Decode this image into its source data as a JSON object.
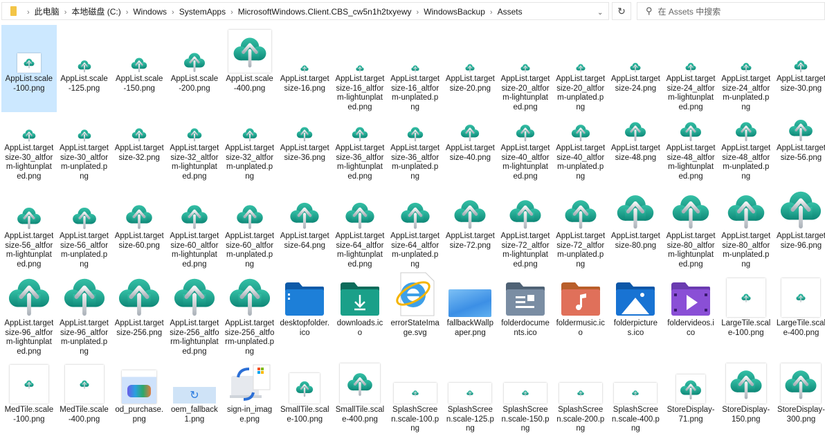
{
  "address_bar": {
    "breadcrumb": [
      "此电脑",
      "本地磁盘 (C:)",
      "Windows",
      "SystemApps",
      "MicrosoftWindows.Client.CBS_cw5n1h2txyewy",
      "WindowsBackup",
      "Assets"
    ]
  },
  "search": {
    "placeholder": "在 Assets 中搜索"
  },
  "icons": {
    "refresh": "refresh-icon",
    "dropdown": "chevron-down-icon",
    "search": "search-icon"
  },
  "colors": {
    "selection": "#cce8ff",
    "cloud": "#1fa38f"
  },
  "files": [
    {
      "name": "AppList.scale-100.png",
      "icon": "cloud-thumb"
    },
    {
      "name": "AppList.scale-125.png",
      "icon": "cloud"
    },
    {
      "name": "AppList.scale-150.png",
      "icon": "cloud"
    },
    {
      "name": "AppList.scale-200.png",
      "icon": "cloud"
    },
    {
      "name": "AppList.scale-400.png",
      "icon": "cloud-thumb"
    },
    {
      "name": "AppList.targetsize-16.png",
      "icon": "cloud"
    },
    {
      "name": "AppList.targetsize-16_altform-lightunplated.png",
      "icon": "cloud"
    },
    {
      "name": "AppList.targetsize-16_altform-unplated.png",
      "icon": "cloud"
    },
    {
      "name": "AppList.targetsize-20.png",
      "icon": "cloud"
    },
    {
      "name": "AppList.targetsize-20_altform-lightunplated.png",
      "icon": "cloud"
    },
    {
      "name": "AppList.targetsize-20_altform-unplated.png",
      "icon": "cloud"
    },
    {
      "name": "AppList.targetsize-24.png",
      "icon": "cloud"
    },
    {
      "name": "AppList.targetsize-24_altform-lightunplated.png",
      "icon": "cloud"
    },
    {
      "name": "AppList.targetsize-24_altform-unplated.png",
      "icon": "cloud"
    },
    {
      "name": "AppList.targetsize-30.png",
      "icon": "cloud"
    },
    {
      "name": "AppList.targetsize-30_altform-lightunplated.png",
      "icon": "cloud"
    },
    {
      "name": "AppList.targetsize-30_altform-unplated.png",
      "icon": "cloud"
    },
    {
      "name": "AppList.targetsize-32.png",
      "icon": "cloud"
    },
    {
      "name": "AppList.targetsize-32_altform-lightunplated.png",
      "icon": "cloud"
    },
    {
      "name": "AppList.targetsize-32_altform-unplated.png",
      "icon": "cloud"
    },
    {
      "name": "AppList.targetsize-36.png",
      "icon": "cloud"
    },
    {
      "name": "AppList.targetsize-36_altform-lightunplated.png",
      "icon": "cloud"
    },
    {
      "name": "AppList.targetsize-36_altform-unplated.png",
      "icon": "cloud"
    },
    {
      "name": "AppList.targetsize-40.png",
      "icon": "cloud"
    },
    {
      "name": "AppList.targetsize-40_altform-lightunplated.png",
      "icon": "cloud"
    },
    {
      "name": "AppList.targetsize-40_altform-unplated.png",
      "icon": "cloud"
    },
    {
      "name": "AppList.targetsize-48.png",
      "icon": "cloud"
    },
    {
      "name": "AppList.targetsize-48_altform-lightunplated.png",
      "icon": "cloud"
    },
    {
      "name": "AppList.targetsize-48_altform-unplated.png",
      "icon": "cloud"
    },
    {
      "name": "AppList.targetsize-56.png",
      "icon": "cloud"
    },
    {
      "name": "AppList.targetsize-56_altform-lightunplated.png",
      "icon": "cloud"
    },
    {
      "name": "AppList.targetsize-56_altform-unplated.png",
      "icon": "cloud"
    },
    {
      "name": "AppList.targetsize-60.png",
      "icon": "cloud"
    },
    {
      "name": "AppList.targetsize-60_altform-lightunplated.png",
      "icon": "cloud"
    },
    {
      "name": "AppList.targetsize-60_altform-unplated.png",
      "icon": "cloud"
    },
    {
      "name": "AppList.targetsize-64.png",
      "icon": "cloud"
    },
    {
      "name": "AppList.targetsize-64_altform-lightunplated.png",
      "icon": "cloud"
    },
    {
      "name": "AppList.targetsize-64_altform-unplated.png",
      "icon": "cloud"
    },
    {
      "name": "AppList.targetsize-72.png",
      "icon": "cloud"
    },
    {
      "name": "AppList.targetsize-72_altform-lightunplated.png",
      "icon": "cloud"
    },
    {
      "name": "AppList.targetsize-72_altform-unplated.png",
      "icon": "cloud"
    },
    {
      "name": "AppList.targetsize-80.png",
      "icon": "cloud"
    },
    {
      "name": "AppList.targetsize-80_altform-lightunplated.png",
      "icon": "cloud"
    },
    {
      "name": "AppList.targetsize-80_altform-unplated.png",
      "icon": "cloud"
    },
    {
      "name": "AppList.targetsize-96.png",
      "icon": "cloud"
    },
    {
      "name": "AppList.targetsize-96_altform-lightunplated.png",
      "icon": "cloud"
    },
    {
      "name": "AppList.targetsize-96_altform-unplated.png",
      "icon": "cloud"
    },
    {
      "name": "AppList.targetsize-256.png",
      "icon": "cloud"
    },
    {
      "name": "AppList.targetsize-256_altform-lightunplated.png",
      "icon": "cloud"
    },
    {
      "name": "AppList.targetsize-256_altform-unplated.png",
      "icon": "cloud"
    },
    {
      "name": "desktopfolder.ico",
      "icon": "folder-desktop"
    },
    {
      "name": "downloads.ico",
      "icon": "folder-downloads"
    },
    {
      "name": "errorStateImage.svg",
      "icon": "ie-file"
    },
    {
      "name": "fallbackWallpaper.png",
      "icon": "wallpaper"
    },
    {
      "name": "folderdocuments.ico",
      "icon": "folder-documents"
    },
    {
      "name": "foldermusic.ico",
      "icon": "folder-music"
    },
    {
      "name": "folderpictures.ico",
      "icon": "folder-pictures"
    },
    {
      "name": "foldervideos.ico",
      "icon": "folder-videos"
    },
    {
      "name": "LargeTile.scale-100.png",
      "icon": "cloud-thumb"
    },
    {
      "name": "LargeTile.scale-400.png",
      "icon": "cloud-thumb"
    },
    {
      "name": "MedTile.scale-100.png",
      "icon": "cloud-thumb"
    },
    {
      "name": "MedTile.scale-400.png",
      "icon": "cloud-thumb"
    },
    {
      "name": "od_purchase.png",
      "icon": "purchase-image"
    },
    {
      "name": "oem_fallback1.png",
      "icon": "oem-image"
    },
    {
      "name": "sign-in_image.png",
      "icon": "signin-image"
    },
    {
      "name": "SmallTile.scale-100.png",
      "icon": "cloud-thumb"
    },
    {
      "name": "SmallTile.scale-400.png",
      "icon": "cloud-thumb"
    },
    {
      "name": "SplashScreen.scale-100.png",
      "icon": "splash-thumb"
    },
    {
      "name": "SplashScreen.scale-125.png",
      "icon": "splash-thumb"
    },
    {
      "name": "SplashScreen.scale-150.png",
      "icon": "splash-thumb"
    },
    {
      "name": "SplashScreen.scale-200.png",
      "icon": "splash-thumb"
    },
    {
      "name": "SplashScreen.scale-400.png",
      "icon": "splash-thumb"
    },
    {
      "name": "StoreDisplay-71.png",
      "icon": "cloud-thumb"
    },
    {
      "name": "StoreDisplay-150.png",
      "icon": "cloud-thumb"
    },
    {
      "name": "StoreDisplay-300.png",
      "icon": "cloud-thumb"
    }
  ]
}
